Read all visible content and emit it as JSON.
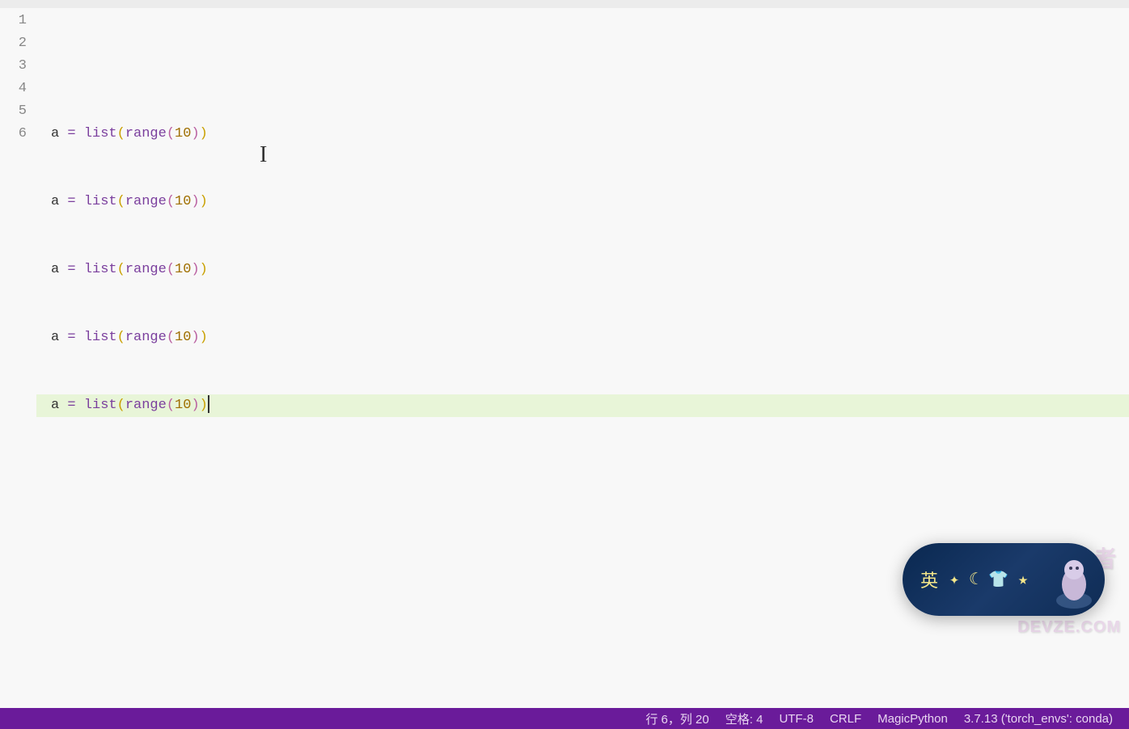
{
  "editor": {
    "lines": [
      {
        "n": 1,
        "text": ""
      },
      {
        "n": 2,
        "text": "    a = list(range(10))"
      },
      {
        "n": 3,
        "text": "    a = list(range(10))"
      },
      {
        "n": 4,
        "text": "    a = list(range(10))"
      },
      {
        "n": 5,
        "text": "    a = list(range(10))"
      },
      {
        "n": 6,
        "text": "    a = list(range(10))",
        "active": true
      }
    ],
    "tokens": {
      "id": "a",
      "op": "=",
      "fn1": "list",
      "fn2": "range",
      "num": "10"
    }
  },
  "status": {
    "line_col": "行 6，列 20",
    "indent": "空格: 4",
    "encoding": "UTF-8",
    "eol": "CRLF",
    "language": "MagicPython",
    "interpreter": "3.7.13 ('torch_envs': conda)"
  },
  "ime": {
    "mode": "英",
    "icons": [
      "moon",
      "shirt",
      "star"
    ]
  },
  "watermark": {
    "line1": "开发者",
    "line2": "DEVZE.COM"
  }
}
